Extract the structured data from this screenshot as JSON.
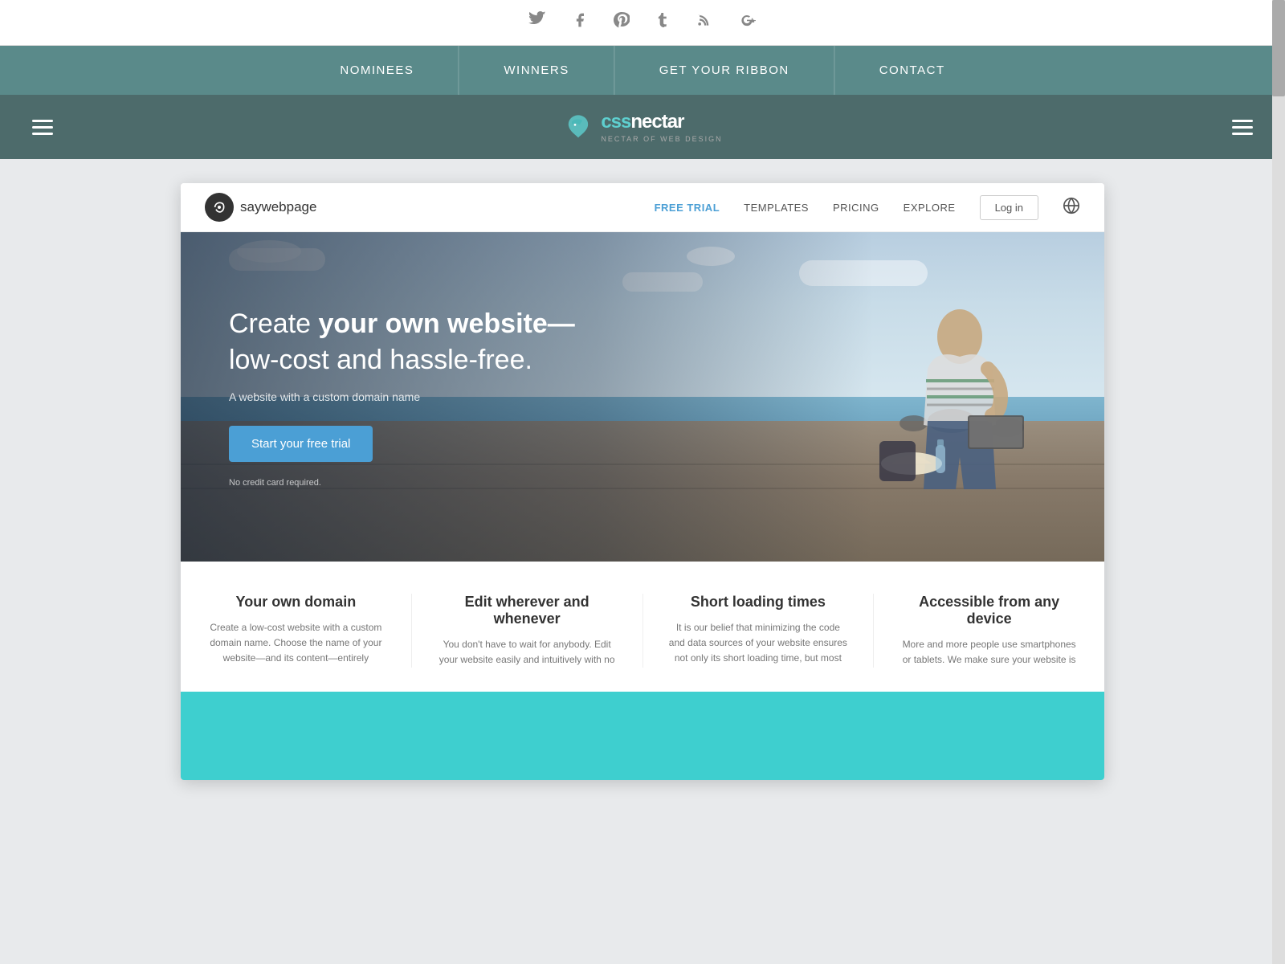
{
  "social": {
    "icons": [
      {
        "name": "twitter-icon",
        "symbol": "𝕏",
        "unicode": "🐦"
      },
      {
        "name": "facebook-icon",
        "symbol": "f"
      },
      {
        "name": "pinterest-icon",
        "symbol": "P"
      },
      {
        "name": "tumblr-icon",
        "symbol": "t"
      },
      {
        "name": "rss-icon",
        "symbol": "◉"
      },
      {
        "name": "googleplus-icon",
        "symbol": "g+"
      }
    ]
  },
  "nav": {
    "items": [
      {
        "label": "NOMINEES",
        "id": "nominees"
      },
      {
        "label": "WINNERS",
        "id": "winners"
      },
      {
        "label": "GET YOUR RIBBON",
        "id": "get-ribbon"
      },
      {
        "label": "CONTACT",
        "id": "contact"
      }
    ]
  },
  "header": {
    "logo_css": "css",
    "logo_nectar": "nectar",
    "logo_tagline": "NECTAR OF WEB DESIGN"
  },
  "site": {
    "logo_text": "saywebpage",
    "nav_items": [
      {
        "label": "FREE TRIAL",
        "active": true
      },
      {
        "label": "TEMPLATES",
        "active": false
      },
      {
        "label": "PRICING",
        "active": false
      },
      {
        "label": "EXPLORE",
        "active": false
      }
    ],
    "login_label": "Log in",
    "hero": {
      "title_normal": "Create ",
      "title_bold": "your own website—",
      "title_line2": "low-cost and hassle-free.",
      "subtitle": "A website with a custom domain name",
      "cta_label": "Start your free trial",
      "no_card_text": "No credit card required."
    },
    "features": [
      {
        "title": "Your own domain",
        "text": "Create a low-cost website with a custom domain name. Choose the name of your website—and its content—entirely"
      },
      {
        "title": "Edit wherever and whenever",
        "text": "You don't have to wait for anybody. Edit your website easily and intuitively with no"
      },
      {
        "title": "Short loading times",
        "text": "It is our belief that minimizing the code and data sources of your website ensures not only its short loading time, but most"
      },
      {
        "title": "Accessible from any device",
        "text": "More and more people use smartphones or tablets. We make sure your website is"
      }
    ]
  },
  "colors": {
    "nav_bg": "#5a8a8a",
    "header_bg": "#4d6b6b",
    "accent_blue": "#4b9fd5",
    "teal": "#3ecfcf",
    "text_dark": "#333333",
    "text_mid": "#666666",
    "text_light": "#888888"
  }
}
